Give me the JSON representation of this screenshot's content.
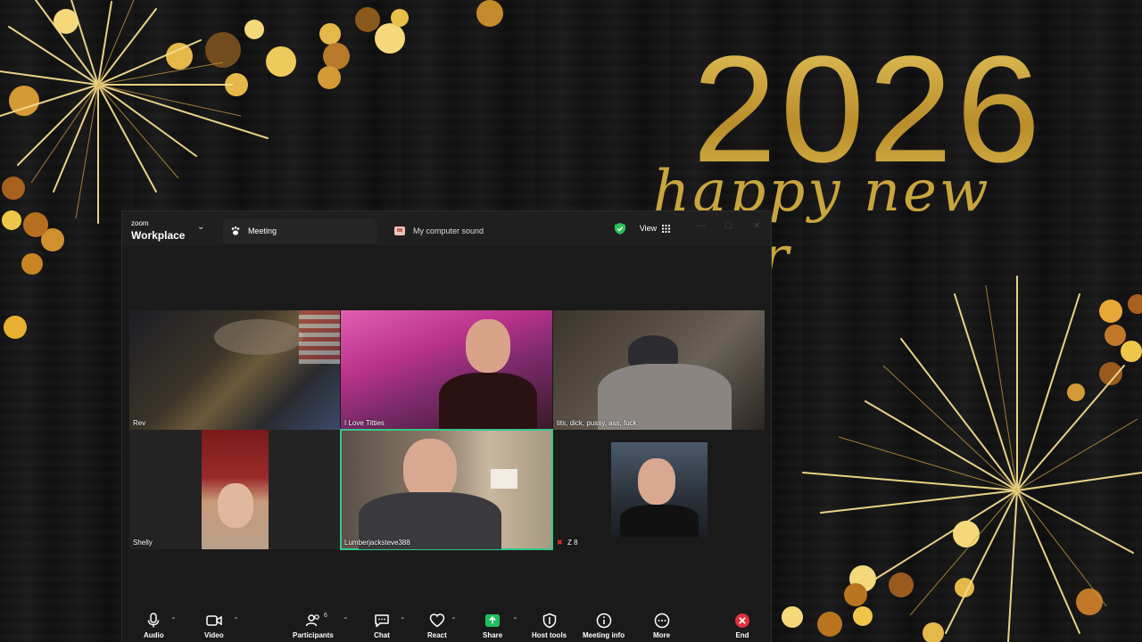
{
  "background": {
    "year": "2026",
    "greeting": "happy new year"
  },
  "window": {
    "brand_small": "zoom",
    "brand_big": "Workplace",
    "tabs": [
      {
        "label": "Meeting",
        "icon": "paw-icon"
      },
      {
        "label": "My computer sound",
        "icon": "sound-icon"
      }
    ],
    "view_label": "View"
  },
  "participants": [
    {
      "name": "Rev"
    },
    {
      "name": "I Love Titties"
    },
    {
      "name": "tits, dick, pussy, ass, fuck"
    },
    {
      "name": "Shelly"
    },
    {
      "name": "Lumberjacksteve388"
    },
    {
      "name": "Z 8"
    }
  ],
  "toolbar": {
    "audio": "Audio",
    "video": "Video",
    "participants": "Participants",
    "participants_count": "6",
    "chat": "Chat",
    "react": "React",
    "share": "Share",
    "host_tools": "Host tools",
    "meeting_info": "Meeting info",
    "more": "More",
    "end": "End"
  },
  "colors": {
    "gold": "#c9a53d",
    "active_speaker": "#34c78a",
    "share_green": "#1fbf5f",
    "end_red": "#e0303a"
  }
}
